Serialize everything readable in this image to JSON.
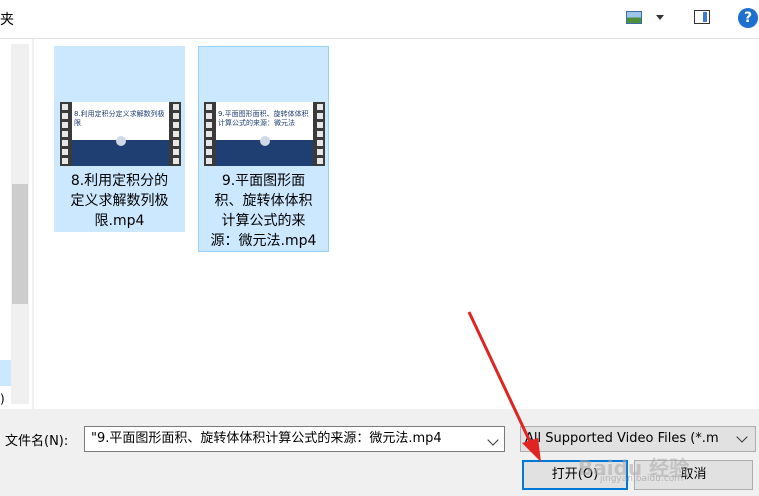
{
  "header": {
    "title": "夹",
    "view_icon": "change-view-icon",
    "dropdown_icon": "chevron-down-icon",
    "preview_icon": "preview-pane-icon",
    "help_icon": "help-icon",
    "help_label": "?"
  },
  "left": {
    "glyph": ")"
  },
  "files": [
    {
      "name": "8.利用定积分的定义求解数列极限.mp4",
      "lines": [
        "8.利用定积分的",
        "定义求解数列极",
        "限.mp4"
      ],
      "thumb_caption": "8.利用定积分定义求解数列极限"
    },
    {
      "name": "9.平面图形面积、旋转体体积计算公式的来源：微元法.mp4",
      "lines": [
        "9.平面图形面",
        "积、旋转体体积",
        "计算公式的来",
        "源：微元法.mp4"
      ],
      "thumb_caption": "9.平面图形面积、旋转体体积计算公式的来源：微元法"
    }
  ],
  "bottom": {
    "filename_label": "文件名(N):",
    "filename_value": "\"9.平面图形面积、旋转体体积计算公式的来源：微元法.mp4",
    "filetype_value": "All Supported Video Files (*.m",
    "open_label": "打开(O)",
    "cancel_label": "取消"
  },
  "colors": {
    "selection": "#cce8ff",
    "selection_border": "#99d1ff",
    "accent": "#0078d7",
    "annotation_arrow": "#e02424"
  },
  "watermark": {
    "text": "Baidu 经验",
    "url_text": "jingyan.baidu.com"
  }
}
